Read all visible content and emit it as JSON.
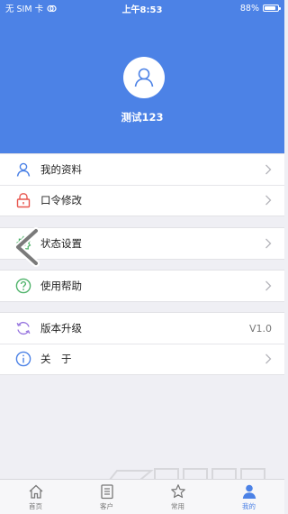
{
  "status_bar": {
    "carrier": "无 SIM 卡",
    "time": "上午8:53",
    "battery_percent": "88%",
    "battery_level": 0.88
  },
  "profile": {
    "username": "测试123"
  },
  "menu": {
    "profile": "我的资料",
    "password": "口令修改",
    "status": "状态设置",
    "help": "使用帮助",
    "upgrade": "版本升级",
    "upgrade_value": "V1.0",
    "about": "关　于"
  },
  "tabbar": {
    "tabs": [
      {
        "label": "首页",
        "icon": "home-icon"
      },
      {
        "label": "客户",
        "icon": "customer-icon"
      },
      {
        "label": "常用",
        "icon": "star-icon"
      },
      {
        "label": "我的",
        "icon": "user-icon"
      }
    ],
    "active_index": 3
  },
  "colors": {
    "header": "#4c82e6",
    "accent": "#4c82e6",
    "red_icon": "#e8564e",
    "green_icon": "#4fb36a",
    "purple_icon": "#9b7be0"
  }
}
